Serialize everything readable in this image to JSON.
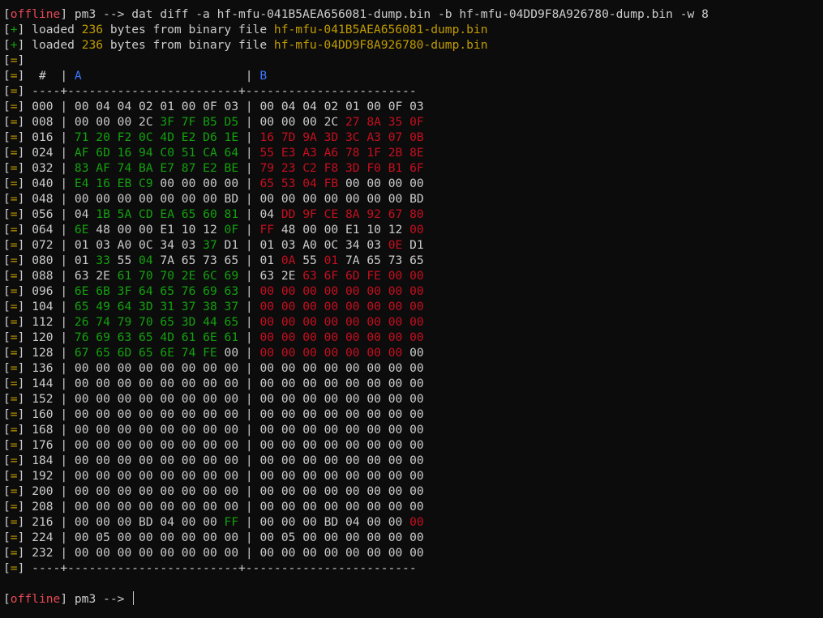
{
  "prompt": {
    "status": "offline",
    "prompt_text": " pm3 --> ",
    "command": "dat diff -a hf-mfu-041B5AEA656081-dump.bin -b hf-mfu-04DD9F8A926780-dump.bin -w 8"
  },
  "messages": [
    {
      "tag": "+",
      "pre": " loaded ",
      "count": "236",
      "mid": " bytes from binary file ",
      "file": "hf-mfu-041B5AEA656081-dump.bin"
    },
    {
      "tag": "+",
      "pre": " loaded ",
      "count": "236",
      "mid": " bytes from binary file ",
      "file": "hf-mfu-04DD9F8A926780-dump.bin"
    }
  ],
  "info_tag": "=",
  "table": {
    "header": {
      "offset_label": "  #  ",
      "a_label": "A",
      "b_label": "B"
    },
    "separator": " ----+------------------------+------------------------",
    "rows": [
      {
        "offset": "000",
        "a": [
          "00",
          "04",
          "04",
          "02",
          "01",
          "00",
          "0F",
          "03"
        ],
        "b": [
          "00",
          "04",
          "04",
          "02",
          "01",
          "00",
          "0F",
          "03"
        ]
      },
      {
        "offset": "008",
        "a": [
          "00",
          "00",
          "00",
          "2C",
          "3F",
          "7F",
          "B5",
          "D5"
        ],
        "b": [
          "00",
          "00",
          "00",
          "2C",
          "27",
          "8A",
          "35",
          "0F"
        ]
      },
      {
        "offset": "016",
        "a": [
          "71",
          "20",
          "F2",
          "0C",
          "4D",
          "E2",
          "D6",
          "1E"
        ],
        "b": [
          "16",
          "7D",
          "9A",
          "3D",
          "3C",
          "A3",
          "07",
          "0B"
        ]
      },
      {
        "offset": "024",
        "a": [
          "AF",
          "6D",
          "16",
          "94",
          "C0",
          "51",
          "CA",
          "64"
        ],
        "b": [
          "55",
          "E3",
          "A3",
          "A6",
          "78",
          "1F",
          "2B",
          "8E"
        ]
      },
      {
        "offset": "032",
        "a": [
          "83",
          "AF",
          "74",
          "BA",
          "E7",
          "87",
          "E2",
          "BE"
        ],
        "b": [
          "79",
          "23",
          "C2",
          "F8",
          "3D",
          "F0",
          "B1",
          "6F"
        ]
      },
      {
        "offset": "040",
        "a": [
          "E4",
          "16",
          "EB",
          "C9",
          "00",
          "00",
          "00",
          "00"
        ],
        "b": [
          "65",
          "53",
          "04",
          "FB",
          "00",
          "00",
          "00",
          "00"
        ]
      },
      {
        "offset": "048",
        "a": [
          "00",
          "00",
          "00",
          "00",
          "00",
          "00",
          "00",
          "BD"
        ],
        "b": [
          "00",
          "00",
          "00",
          "00",
          "00",
          "00",
          "00",
          "BD"
        ]
      },
      {
        "offset": "056",
        "a": [
          "04",
          "1B",
          "5A",
          "CD",
          "EA",
          "65",
          "60",
          "81"
        ],
        "b": [
          "04",
          "DD",
          "9F",
          "CE",
          "8A",
          "92",
          "67",
          "80"
        ]
      },
      {
        "offset": "064",
        "a": [
          "6E",
          "48",
          "00",
          "00",
          "E1",
          "10",
          "12",
          "0F"
        ],
        "b": [
          "FF",
          "48",
          "00",
          "00",
          "E1",
          "10",
          "12",
          "00"
        ]
      },
      {
        "offset": "072",
        "a": [
          "01",
          "03",
          "A0",
          "0C",
          "34",
          "03",
          "37",
          "D1"
        ],
        "b": [
          "01",
          "03",
          "A0",
          "0C",
          "34",
          "03",
          "0E",
          "D1"
        ]
      },
      {
        "offset": "080",
        "a": [
          "01",
          "33",
          "55",
          "04",
          "7A",
          "65",
          "73",
          "65"
        ],
        "b": [
          "01",
          "0A",
          "55",
          "01",
          "7A",
          "65",
          "73",
          "65"
        ]
      },
      {
        "offset": "088",
        "a": [
          "63",
          "2E",
          "61",
          "70",
          "70",
          "2E",
          "6C",
          "69"
        ],
        "b": [
          "63",
          "2E",
          "63",
          "6F",
          "6D",
          "FE",
          "00",
          "00"
        ]
      },
      {
        "offset": "096",
        "a": [
          "6E",
          "6B",
          "3F",
          "64",
          "65",
          "76",
          "69",
          "63"
        ],
        "b": [
          "00",
          "00",
          "00",
          "00",
          "00",
          "00",
          "00",
          "00"
        ]
      },
      {
        "offset": "104",
        "a": [
          "65",
          "49",
          "64",
          "3D",
          "31",
          "37",
          "38",
          "37"
        ],
        "b": [
          "00",
          "00",
          "00",
          "00",
          "00",
          "00",
          "00",
          "00"
        ]
      },
      {
        "offset": "112",
        "a": [
          "26",
          "74",
          "79",
          "70",
          "65",
          "3D",
          "44",
          "65"
        ],
        "b": [
          "00",
          "00",
          "00",
          "00",
          "00",
          "00",
          "00",
          "00"
        ]
      },
      {
        "offset": "120",
        "a": [
          "76",
          "69",
          "63",
          "65",
          "4D",
          "61",
          "6E",
          "61"
        ],
        "b": [
          "00",
          "00",
          "00",
          "00",
          "00",
          "00",
          "00",
          "00"
        ]
      },
      {
        "offset": "128",
        "a": [
          "67",
          "65",
          "6D",
          "65",
          "6E",
          "74",
          "FE",
          "00"
        ],
        "b": [
          "00",
          "00",
          "00",
          "00",
          "00",
          "00",
          "00",
          "00"
        ]
      },
      {
        "offset": "136",
        "a": [
          "00",
          "00",
          "00",
          "00",
          "00",
          "00",
          "00",
          "00"
        ],
        "b": [
          "00",
          "00",
          "00",
          "00",
          "00",
          "00",
          "00",
          "00"
        ]
      },
      {
        "offset": "144",
        "a": [
          "00",
          "00",
          "00",
          "00",
          "00",
          "00",
          "00",
          "00"
        ],
        "b": [
          "00",
          "00",
          "00",
          "00",
          "00",
          "00",
          "00",
          "00"
        ]
      },
      {
        "offset": "152",
        "a": [
          "00",
          "00",
          "00",
          "00",
          "00",
          "00",
          "00",
          "00"
        ],
        "b": [
          "00",
          "00",
          "00",
          "00",
          "00",
          "00",
          "00",
          "00"
        ]
      },
      {
        "offset": "160",
        "a": [
          "00",
          "00",
          "00",
          "00",
          "00",
          "00",
          "00",
          "00"
        ],
        "b": [
          "00",
          "00",
          "00",
          "00",
          "00",
          "00",
          "00",
          "00"
        ]
      },
      {
        "offset": "168",
        "a": [
          "00",
          "00",
          "00",
          "00",
          "00",
          "00",
          "00",
          "00"
        ],
        "b": [
          "00",
          "00",
          "00",
          "00",
          "00",
          "00",
          "00",
          "00"
        ]
      },
      {
        "offset": "176",
        "a": [
          "00",
          "00",
          "00",
          "00",
          "00",
          "00",
          "00",
          "00"
        ],
        "b": [
          "00",
          "00",
          "00",
          "00",
          "00",
          "00",
          "00",
          "00"
        ]
      },
      {
        "offset": "184",
        "a": [
          "00",
          "00",
          "00",
          "00",
          "00",
          "00",
          "00",
          "00"
        ],
        "b": [
          "00",
          "00",
          "00",
          "00",
          "00",
          "00",
          "00",
          "00"
        ]
      },
      {
        "offset": "192",
        "a": [
          "00",
          "00",
          "00",
          "00",
          "00",
          "00",
          "00",
          "00"
        ],
        "b": [
          "00",
          "00",
          "00",
          "00",
          "00",
          "00",
          "00",
          "00"
        ]
      },
      {
        "offset": "200",
        "a": [
          "00",
          "00",
          "00",
          "00",
          "00",
          "00",
          "00",
          "00"
        ],
        "b": [
          "00",
          "00",
          "00",
          "00",
          "00",
          "00",
          "00",
          "00"
        ]
      },
      {
        "offset": "208",
        "a": [
          "00",
          "00",
          "00",
          "00",
          "00",
          "00",
          "00",
          "00"
        ],
        "b": [
          "00",
          "00",
          "00",
          "00",
          "00",
          "00",
          "00",
          "00"
        ]
      },
      {
        "offset": "216",
        "a": [
          "00",
          "00",
          "00",
          "BD",
          "04",
          "00",
          "00",
          "FF"
        ],
        "b": [
          "00",
          "00",
          "00",
          "BD",
          "04",
          "00",
          "00",
          "00"
        ]
      },
      {
        "offset": "224",
        "a": [
          "00",
          "05",
          "00",
          "00",
          "00",
          "00",
          "00",
          "00"
        ],
        "b": [
          "00",
          "05",
          "00",
          "00",
          "00",
          "00",
          "00",
          "00"
        ]
      },
      {
        "offset": "232",
        "a": [
          "00",
          "00",
          "00",
          "00",
          "00",
          "00",
          "00",
          "00"
        ],
        "b": [
          "00",
          "00",
          "00",
          "00",
          "00",
          "00",
          "00",
          "00"
        ]
      }
    ]
  },
  "colors": {
    "status_red": "#e74856",
    "ok_green": "#13a10e",
    "highlight_yellow": "#c19c00",
    "header_blue": "#3b78ff",
    "diff_a_green": "#13a10e",
    "diff_b_red": "#c50f1f",
    "text": "#cccccc",
    "background": "#0c0c0c"
  }
}
